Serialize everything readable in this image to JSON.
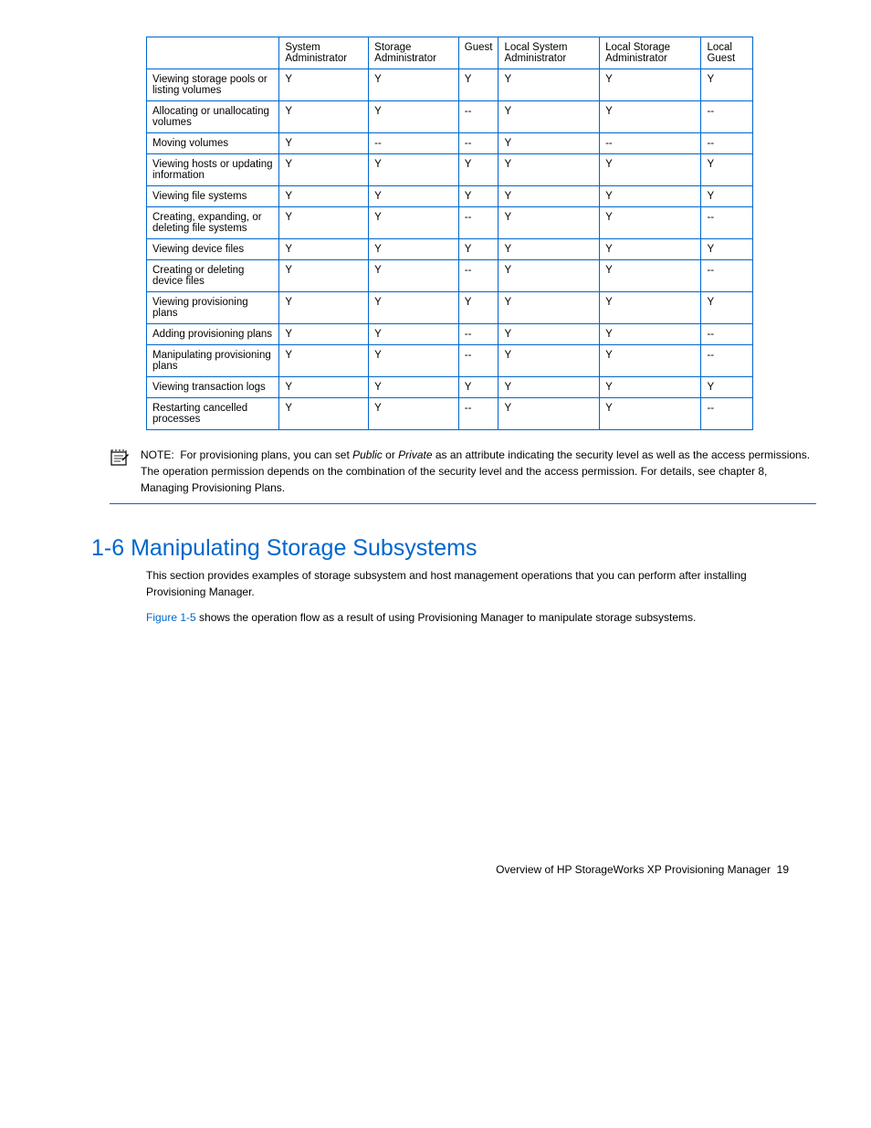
{
  "table": {
    "headers": [
      "",
      "System Administrator",
      "Storage Administrator",
      "Guest",
      "Local System Administrator",
      "Local Storage Administrator",
      "Local Guest"
    ],
    "rows": [
      {
        "label": "Viewing storage pools or listing volumes",
        "cells": [
          "Y",
          "Y",
          "Y",
          "Y",
          "Y",
          "Y"
        ]
      },
      {
        "label": "Allocating or unallocating volumes",
        "cells": [
          "Y",
          "Y",
          "--",
          "Y",
          "Y",
          "--"
        ]
      },
      {
        "label": "Moving volumes",
        "cells": [
          "Y",
          "--",
          "--",
          "Y",
          "--",
          "--"
        ]
      },
      {
        "label": "Viewing hosts or updating information",
        "cells": [
          "Y",
          "Y",
          "Y",
          "Y",
          "Y",
          "Y"
        ]
      },
      {
        "label": "Viewing file systems",
        "cells": [
          "Y",
          "Y",
          "Y",
          "Y",
          "Y",
          "Y"
        ]
      },
      {
        "label": "Creating, expanding, or deleting file systems",
        "cells": [
          "Y",
          "Y",
          "--",
          "Y",
          "Y",
          "--"
        ]
      },
      {
        "label": "Viewing device files",
        "cells": [
          "Y",
          "Y",
          "Y",
          "Y",
          "Y",
          "Y"
        ]
      },
      {
        "label": "Creating or deleting device files",
        "cells": [
          "Y",
          "Y",
          "--",
          "Y",
          "Y",
          "--"
        ]
      },
      {
        "label": "Viewing provisioning plans",
        "cells": [
          "Y",
          "Y",
          "Y",
          "Y",
          "Y",
          "Y"
        ]
      },
      {
        "label": "Adding provisioning plans",
        "cells": [
          "Y",
          "Y",
          "--",
          "Y",
          "Y",
          "--"
        ]
      },
      {
        "label": "Manipulating provisioning plans",
        "cells": [
          "Y",
          "Y",
          "--",
          "Y",
          "Y",
          "--"
        ]
      },
      {
        "label": "Viewing transaction logs",
        "cells": [
          "Y",
          "Y",
          "Y",
          "Y",
          "Y",
          "Y"
        ]
      },
      {
        "label": "Restarting cancelled processes",
        "cells": [
          "Y",
          "Y",
          "--",
          "Y",
          "Y",
          "--"
        ]
      }
    ]
  },
  "note": {
    "label": "NOTE:",
    "text_before": "For provisioning plans, you can set",
    "italic1": "Public",
    "or": " or ",
    "italic2": "Private",
    "text_after": " as an attribute indicating the security level as well as the access permissions. The operation permission depends on the combination of the security level and the access permission. For details, see chapter 8, Managing Provisioning Plans."
  },
  "section": {
    "heading": "1-6 Manipulating Storage Subsystems",
    "p1": "This section provides examples of storage subsystem and host management operations that you can perform after installing Provisioning Manager.",
    "p2_ref": "Figure 1-5",
    "p2_rest": " shows the operation flow as a result of using Provisioning Manager to manipulate storage subsystems."
  },
  "footer": {
    "text": "Overview of HP StorageWorks XP Provisioning Manager",
    "page": "19"
  }
}
